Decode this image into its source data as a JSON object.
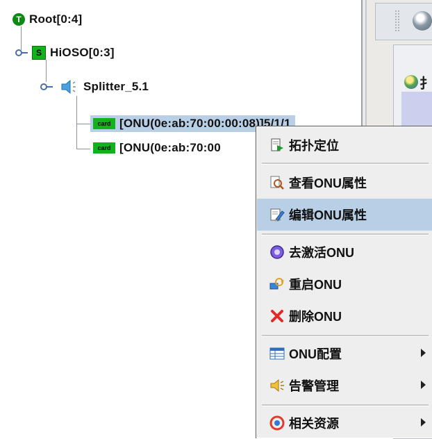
{
  "tree": {
    "root": {
      "icon": "T",
      "label": "Root[0:4]"
    },
    "group": {
      "icon": "S",
      "label": "HiOSO[0:3]"
    },
    "splitter": {
      "label": "Splitter_5.1"
    },
    "onus": [
      {
        "icon": "card",
        "label": "[ONU(0e:ab:70:00:00:08)]5/1/1",
        "selected": true
      },
      {
        "icon": "card",
        "label": "[ONU(0e:ab:70:00",
        "selected": false
      }
    ]
  },
  "right_panel": {
    "cut_label": "扌"
  },
  "context_menu": {
    "items": [
      {
        "label": "拓扑定位",
        "icon": "locate-icon"
      },
      {
        "label": "查看ONU属性",
        "icon": "view-properties-icon"
      },
      {
        "label": "编辑ONU属性",
        "icon": "edit-properties-icon",
        "highlighted": true
      },
      {
        "label": "去激活ONU",
        "icon": "deactivate-icon"
      },
      {
        "label": "重启ONU",
        "icon": "restart-icon"
      },
      {
        "label": "删除ONU",
        "icon": "delete-icon"
      },
      {
        "label": "ONU配置",
        "icon": "config-icon",
        "submenu": true
      },
      {
        "label": "告警管理",
        "icon": "alarm-icon",
        "submenu": true
      },
      {
        "label": "相关资源",
        "icon": "related-resources-icon",
        "submenu": true
      }
    ]
  },
  "colors": {
    "selection": "#b8cfe5",
    "node_green": "#12b21d",
    "menu_bg": "#eeeeee"
  }
}
